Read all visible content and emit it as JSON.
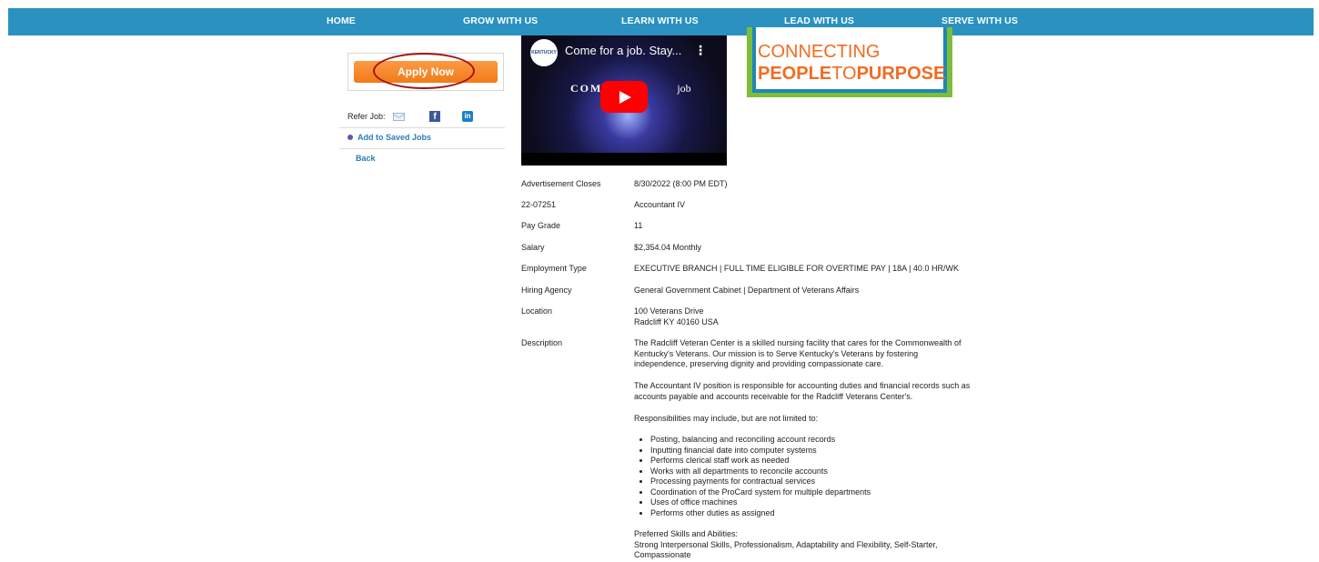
{
  "nav": {
    "items": [
      "HOME",
      "GROW WITH US",
      "LEARN WITH US",
      "LEAD WITH US",
      "SERVE WITH US"
    ],
    "bg_color": "#2a91c0"
  },
  "sidebar": {
    "apply_label": "Apply Now",
    "refer_label": "Refer Job:",
    "refer_icons": [
      "mail-icon",
      "facebook-icon",
      "linkedin-icon"
    ],
    "facebook_glyph": "f",
    "linkedin_glyph": "in",
    "saved_label": "Add to Saved Jobs",
    "back_label": "Back",
    "accent_color": "#f37a17"
  },
  "video": {
    "channel": "KENTUCKY",
    "title": "Come for a job. Stay...",
    "overlay_left": "COM",
    "overlay_right": "job"
  },
  "logo": {
    "line1": "CONNECTING",
    "line2_a": "PEOPLE",
    "line2_b": "TO",
    "line2_c": "PURPOSE"
  },
  "job": {
    "ad_closes_label": "Advertisement Closes",
    "ad_closes": "8/30/2022 (8:00 PM EDT)",
    "job_id": "22-07251",
    "job_title": "Accountant IV",
    "pay_grade_label": "Pay Grade",
    "pay_grade": "11",
    "salary_label": "Salary",
    "salary": "$2,354.04 Monthly",
    "employment_type_label": "Employment Type",
    "employment_type": "EXECUTIVE BRANCH | FULL TIME ELIGIBLE FOR OVERTIME PAY | 18A | 40.0 HR/WK",
    "hiring_agency_label": "Hiring Agency",
    "hiring_agency": "General Government Cabinet | Department of Veterans Affairs",
    "location_label": "Location",
    "location_line1": "100 Veterans Drive",
    "location_line2": "Radcliff KY 40160 USA",
    "description_label": "Description",
    "desc_p1_l1": "The Radcliff Veteran Center is a skilled nursing facility that cares for the Commonwealth of",
    "desc_p1_l2": "Kentucky's Veterans. Our mission is to Serve Kentucky's Veterans by fostering",
    "desc_p1_l3": "independence, preserving dignity and providing compassionate care.",
    "desc_p2_l1": "The Accountant IV position is responsible for accounting duties and financial records such as",
    "desc_p2_l2": "accounts payable and accounts receivable for the Radcliff Veterans Center's.",
    "desc_p3": "Responsibilities may include, but are not limited to:",
    "responsibilities": [
      "Posting, balancing and reconciling account records",
      "Inputting financial date into computer systems",
      "Performs clerical staff work as needed",
      "Works with all departments to reconcile accounts",
      "Processing payments for contractual services",
      "Coordination of the ProCard system for multiple departments",
      "Uses of office machines",
      "Performs other duties as assigned"
    ],
    "skills_label": "Preferred Skills and Abilities:",
    "skills_l1": "Strong Interpersonal Skills, Professionalism, Adaptability and Flexibility, Self-Starter,",
    "skills_l2": "Compassionate"
  }
}
